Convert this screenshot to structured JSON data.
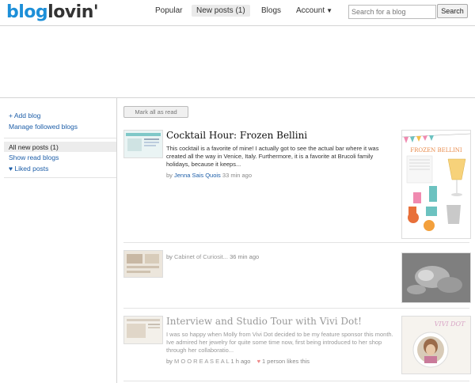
{
  "header": {
    "logo_blog": "blog",
    "logo_lovin": "lovin'",
    "nav": [
      {
        "label": "Popular"
      },
      {
        "label": "New posts (1)"
      },
      {
        "label": "Blogs"
      },
      {
        "label": "Account"
      }
    ],
    "search_placeholder": "Search for a blog",
    "search_button": "Search"
  },
  "sidebar": {
    "add_blog": "+ Add blog",
    "manage": "Manage followed blogs",
    "all_new": "All new posts (1)",
    "show_read": "Show read blogs",
    "liked": "♥ Liked posts"
  },
  "main": {
    "mark_all_read": "Mark all as read",
    "posts": [
      {
        "title": "Cocktail Hour: Frozen Bellini",
        "excerpt": "This cocktail is a favorite of mine! I actually got to see the actual bar where it was created all the way in Venice, Italy. Furthermore, it is a favorite at Brucoli family holidays, because it keeps...",
        "by": "by",
        "author": "Jenna Sais Quois",
        "time": "33 min ago",
        "image_heading": "FROZEN BELLINI"
      },
      {
        "by": "by",
        "author": "Cabinet of Curiosit...",
        "time": "36 min ago"
      },
      {
        "title": "Interview and Studio Tour with Vivi Dot!",
        "excerpt": "I was so happy when Molly from Vivi Dot decided to be my feature sponsor this month.  Ive admired her jewelry for quite some time now, first being introduced to her shop through her collaboratio...",
        "by": "by",
        "author": "M O O R E A S E A L",
        "time": "1 h ago",
        "likes": "1 person likes this",
        "image_heading": "VIVI DOT"
      }
    ]
  },
  "colors": {
    "logo_blue": "#1d8fd8",
    "link_blue": "#1d5ea8"
  }
}
